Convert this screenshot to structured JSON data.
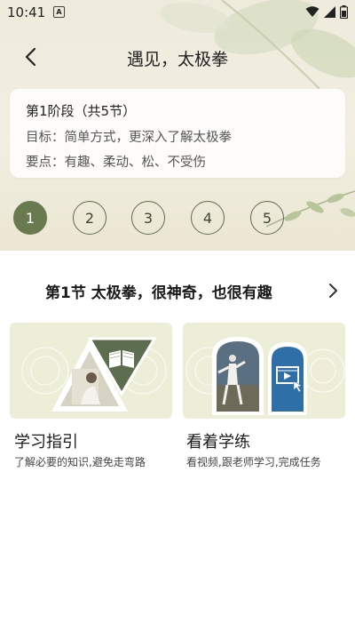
{
  "status_bar": {
    "time": "10:41",
    "notification_letter": "A"
  },
  "header": {
    "title": "遇见，太极拳"
  },
  "stage_card": {
    "stage": "第1阶段（共5节）",
    "goal": "目标：简单方式，更深入了解太极拳",
    "key_points": "要点：有趣、柔动、松、不受伤"
  },
  "steps": [
    {
      "label": "1",
      "active": true
    },
    {
      "label": "2",
      "active": false
    },
    {
      "label": "3",
      "active": false
    },
    {
      "label": "4",
      "active": false
    },
    {
      "label": "5",
      "active": false
    }
  ],
  "section": {
    "title": "第1节  太极拳，很神奇，也很有趣"
  },
  "cards": [
    {
      "title": "学习指引",
      "desc": "了解必要的知识,避免走弯路"
    },
    {
      "title": "看着学练",
      "desc": "看视频,跟老师学习,完成任务"
    }
  ],
  "colors": {
    "accent": "#6a7a4f",
    "card_bg": "#eceed8",
    "video_blue": "#2f6fa8"
  }
}
